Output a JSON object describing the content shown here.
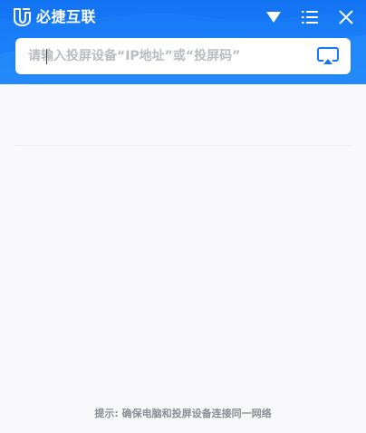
{
  "app": {
    "title": "必捷互联",
    "accent_color": "#1677f5"
  },
  "titlebar": {
    "icons": [
      "logo-icon",
      "dropdown-triangle-icon",
      "menu-list-icon",
      "close-icon"
    ]
  },
  "search": {
    "value": "",
    "placeholder": "请输入投屏设备“IP地址”或“投屏码”",
    "action_icon": "screen-cast-icon"
  },
  "device_list": {
    "items": []
  },
  "footer": {
    "tip": "提示: 确保电脑和投屏设备连接同一网络"
  }
}
